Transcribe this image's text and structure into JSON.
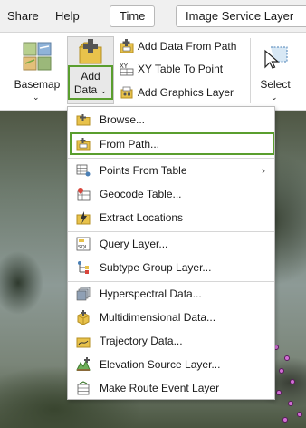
{
  "tabs": {
    "share": "Share",
    "help": "Help",
    "time": "Time",
    "image_service_layer": "Image Service Layer"
  },
  "ribbon": {
    "basemap_label": "Basemap",
    "add_data_label_line1": "Add",
    "add_data_label_line2": "Data",
    "add_data_from_path": "Add Data From Path",
    "xy_table_to_point": "XY Table To Point",
    "add_graphics_layer": "Add Graphics Layer",
    "select_label": "Select"
  },
  "menu": {
    "items": [
      {
        "label": "Browse...",
        "icon": "browse-folder-icon"
      },
      {
        "label": "From Path...",
        "icon": "from-path-icon"
      },
      {
        "label": "Points From Table",
        "icon": "points-from-table-icon"
      },
      {
        "label": "Geocode Table...",
        "icon": "geocode-table-icon"
      },
      {
        "label": "Extract Locations",
        "icon": "extract-locations-icon"
      },
      {
        "label": "Query Layer...",
        "icon": "query-layer-icon"
      },
      {
        "label": "Subtype Group Layer...",
        "icon": "subtype-group-layer-icon"
      },
      {
        "label": "Hyperspectral Data...",
        "icon": "hyperspectral-data-icon"
      },
      {
        "label": "Multidimensional Data...",
        "icon": "multidimensional-data-icon"
      },
      {
        "label": "Trajectory Data...",
        "icon": "trajectory-data-icon"
      },
      {
        "label": "Elevation Source Layer...",
        "icon": "elevation-source-layer-icon"
      },
      {
        "label": "Make Route Event Layer",
        "icon": "route-event-layer-icon"
      }
    ]
  },
  "colors": {
    "highlight_border": "#5a9e2e",
    "folder_yellow": "#e3b83b",
    "map_point_magenta": "#d26fd6"
  }
}
